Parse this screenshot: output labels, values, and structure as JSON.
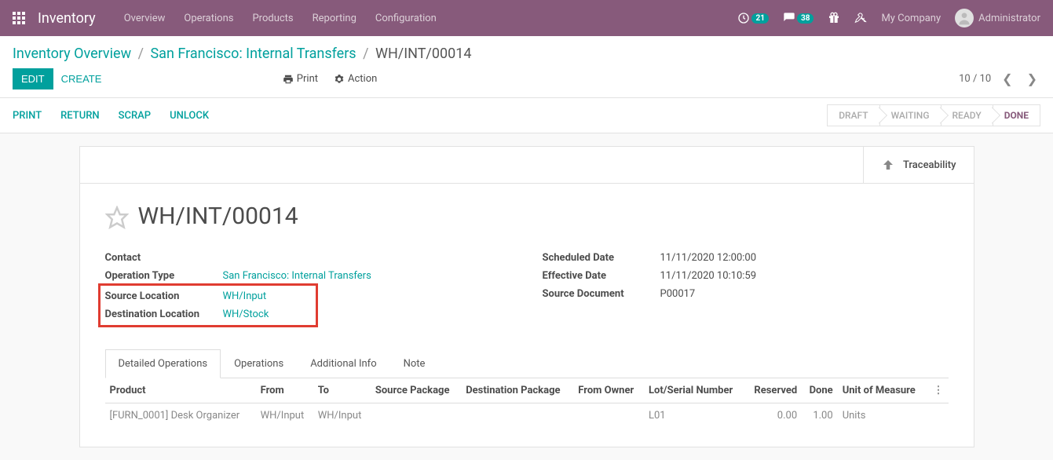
{
  "navbar": {
    "app_name": "Inventory",
    "links": [
      "Overview",
      "Operations",
      "Products",
      "Reporting",
      "Configuration"
    ],
    "clock_badge": "21",
    "chat_badge": "38",
    "company": "My Company",
    "user": "Administrator"
  },
  "breadcrumb": {
    "parts": [
      "Inventory Overview",
      "San Francisco: Internal Transfers",
      "WH/INT/00014"
    ]
  },
  "buttons": {
    "edit": "EDIT",
    "create": "CREATE",
    "print": "Print",
    "action": "Action"
  },
  "pager": {
    "text": "10 / 10"
  },
  "action_links": [
    "PRINT",
    "RETURN",
    "SCRAP",
    "UNLOCK"
  ],
  "statusbar": {
    "stages": [
      "DRAFT",
      "WAITING",
      "READY",
      "DONE"
    ],
    "active": "DONE"
  },
  "stat_button": {
    "label": "Traceability"
  },
  "record": {
    "title": "WH/INT/00014",
    "left": {
      "contact_label": "Contact",
      "contact_value": "",
      "operation_type_label": "Operation Type",
      "operation_type_value": "San Francisco: Internal Transfers",
      "source_location_label": "Source Location",
      "source_location_value": "WH/Input",
      "dest_location_label": "Destination Location",
      "dest_location_value": "WH/Stock"
    },
    "right": {
      "scheduled_date_label": "Scheduled Date",
      "scheduled_date_value": "11/11/2020 12:00:00",
      "effective_date_label": "Effective Date",
      "effective_date_value": "11/11/2020 10:10:59",
      "source_doc_label": "Source Document",
      "source_doc_value": "P00017"
    }
  },
  "tabs": [
    "Detailed Operations",
    "Operations",
    "Additional Info",
    "Note"
  ],
  "table": {
    "headers": [
      "Product",
      "From",
      "To",
      "Source Package",
      "Destination Package",
      "From Owner",
      "Lot/Serial Number",
      "Reserved",
      "Done",
      "Unit of Measure"
    ],
    "rows": [
      {
        "product": "[FURN_0001] Desk Organizer",
        "from": "WH/Input",
        "to": "WH/Input",
        "src_pkg": "",
        "dst_pkg": "",
        "owner": "",
        "lot": "L01",
        "reserved": "0.00",
        "done": "1.00",
        "uom": "Units"
      }
    ]
  }
}
